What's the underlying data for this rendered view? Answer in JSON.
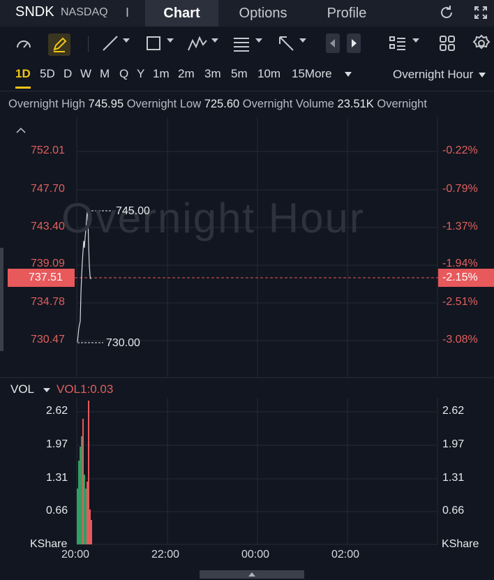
{
  "header": {
    "symbol": "SNDK",
    "exchange": "NASDAQ",
    "separator": "I",
    "tabs": [
      {
        "label": "Chart"
      },
      {
        "label": "Options"
      },
      {
        "label": "Profile"
      }
    ],
    "icons": [
      "refresh-icon",
      "fullscreen-icon"
    ]
  },
  "toolbar": {
    "icons": [
      "indicator-icon",
      "draw-pen-icon",
      "trend-line-icon",
      "rectangle-icon",
      "pattern-icon",
      "fibonacci-icon",
      "arrow-icon",
      "prev-icon",
      "next-icon",
      "layout-list-icon",
      "grid-icon",
      "settings-icon"
    ]
  },
  "periods": {
    "items": [
      "1D",
      "5D",
      "D",
      "W",
      "M",
      "Q",
      "Y",
      "1m",
      "2m",
      "3m",
      "5m",
      "10m",
      "15More"
    ],
    "active": "1D",
    "session": "Overnight Hour"
  },
  "stats": {
    "high_label": "Overnight High",
    "high": "745.95",
    "low_label": "Overnight Low",
    "low": "725.60",
    "volume_label": "Overnight Volume",
    "volume": "23.51K",
    "trail": "Overnight"
  },
  "chart": {
    "watermark": "Overnight Hour",
    "left_ticks": [
      "752.01",
      "747.70",
      "743.40",
      "739.09",
      "734.78",
      "730.47"
    ],
    "right_ticks": [
      "-0.22%",
      "-0.79%",
      "-1.37%",
      "-1.94%",
      "-2.51%",
      "-3.08%"
    ],
    "current_price": "737.51",
    "current_pct": "-2.15%",
    "high_marker": "745.00",
    "low_marker": "730.00",
    "x_ticks": [
      "20:00",
      "22:00",
      "00:00",
      "02:00"
    ]
  },
  "volume": {
    "title": "VOL",
    "value": "VOL1:0.03",
    "left_ticks": [
      "2.62",
      "1.97",
      "1.31",
      "0.66"
    ],
    "right_ticks": [
      "2.62",
      "1.97",
      "1.31",
      "0.66"
    ],
    "unit": "KShare",
    "unit_right": "KShare"
  },
  "colors": {
    "up": "#2f9f64",
    "down": "#e8595c",
    "accent": "#f2c418"
  }
}
